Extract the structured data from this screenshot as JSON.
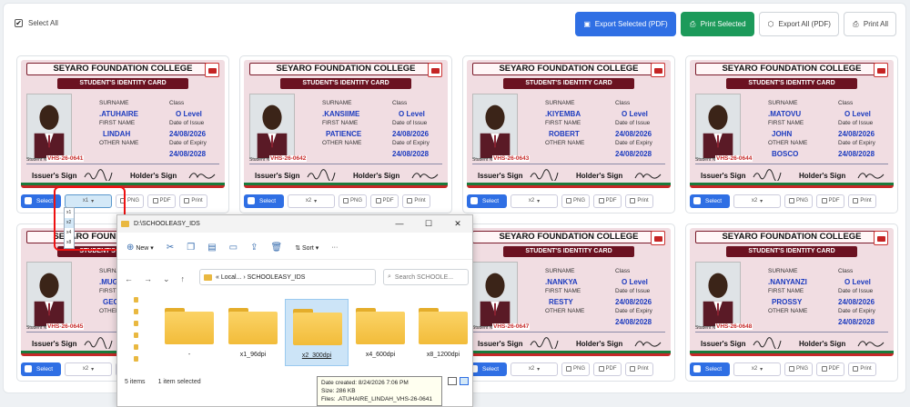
{
  "toolbar": {
    "select_all": "Select All",
    "export_selected": "Export Selected (PDF)",
    "print_selected": "Print Selected",
    "export_all": "Export All (PDF)",
    "print_all": "Print All"
  },
  "card_template": {
    "school": "SEYARO FOUNDATION COLLEGE",
    "card_title": "STUDENT'S IDENTITY CARD",
    "surname_label": "SURNAME",
    "class_label": "Class",
    "first_name_label": "FIRST NAME",
    "doi_label": "Date of Issue",
    "other_name_label": "OTHER NAME",
    "doe_label": "Date of Expiry",
    "student_no_label": "Student No.",
    "issuer_sign": "Issuer's Sign",
    "holder_sign": "Holder's Sign",
    "select_btn": "Select",
    "png_btn": "PNG",
    "pdf_btn": "PDF",
    "print_btn": "Print"
  },
  "cards": [
    {
      "surname": ".ATUHAIRE",
      "class": "O Level",
      "first_name": "LINDAH",
      "doi": "24/08/2026",
      "other_name": "",
      "doe": "24/08/2028",
      "student_no": "VHS-26-0641",
      "scale": "x1"
    },
    {
      "surname": ".KANSIIME",
      "class": "O Level",
      "first_name": "PATIENCE",
      "doi": "24/08/2026",
      "other_name": "",
      "doe": "24/08/2028",
      "student_no": "VHS-26-0642",
      "scale": "x2"
    },
    {
      "surname": ".KIYEMBA",
      "class": "O Level",
      "first_name": "ROBERT",
      "doi": "24/08/2026",
      "other_name": "",
      "doe": "24/08/2028",
      "student_no": "VHS-26-0643",
      "scale": "x2"
    },
    {
      "surname": ".MATOVU",
      "class": "O Level",
      "first_name": "JOHN",
      "doi": "24/08/2026",
      "other_name": "BOSCO",
      "doe": "24/08/2028",
      "student_no": "VHS-26-0644",
      "scale": "x2"
    },
    {
      "surname": ".MUG",
      "class": "",
      "first_name": "GEOR",
      "doi": "",
      "other_name": "",
      "doe": "",
      "student_no": "VHS-26-0645",
      "scale": "x2"
    },
    {
      "surname": ".NANKYA",
      "class": "O Level",
      "first_name": "RESTY",
      "doi": "24/08/2026",
      "other_name": "",
      "doe": "24/08/2028",
      "student_no": "VHS-26-0647",
      "scale": "x2"
    },
    {
      "surname": ".NANYANZI",
      "class": "O Level",
      "first_name": "PROSSY",
      "doi": "24/08/2026",
      "other_name": "",
      "doe": "24/08/2028",
      "student_no": "VHS-26-0648",
      "scale": "x2"
    }
  ],
  "scale_dropdown": {
    "options": [
      "x1",
      "x2",
      "x4",
      "x8"
    ],
    "selected": "x2"
  },
  "explorer": {
    "title": "D:\\SCHOOLEASY_IDS",
    "new_label": "New",
    "sort_label": "Sort",
    "address": "« Local... › SCHOOLEASY_IDS",
    "search_placeholder": "Search SCHOOLE...",
    "folders": [
      "-",
      "x1_96dpi",
      "x2_300dpi",
      "x4_600dpi",
      "x8_1200dpi"
    ],
    "items_count": "5 items",
    "selected_count": "1 item selected",
    "tooltip": {
      "date": "Date created: 8/24/2026 7:06 PM",
      "size": "Size: 286 KB",
      "files": "Files: .ATUHAIRE_LINDAH_VHS-26-0641"
    }
  },
  "colors": {
    "primary": "#2f6fe4",
    "success": "#1c9a5a",
    "card_band": "#6b1221",
    "value_blue": "#1c3bbf",
    "student_no_red": "#c62828"
  }
}
